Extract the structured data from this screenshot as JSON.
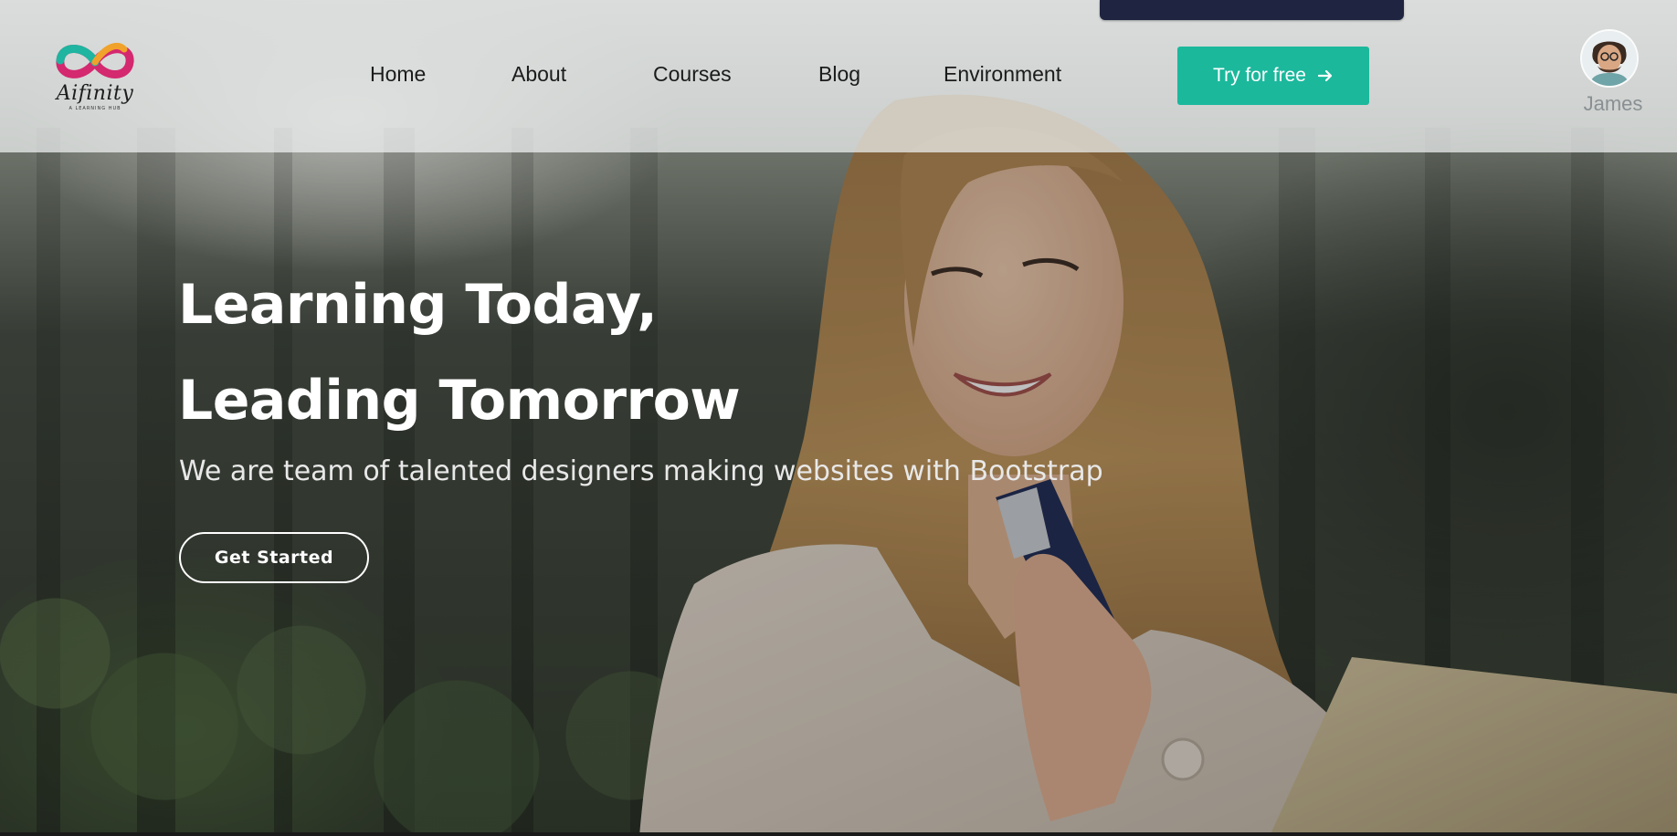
{
  "brand": {
    "name": "Aifinity",
    "tagline": "A LEARNING HUB"
  },
  "nav": {
    "items": [
      {
        "label": "Home"
      },
      {
        "label": "About"
      },
      {
        "label": "Courses"
      },
      {
        "label": "Blog"
      },
      {
        "label": "Environment"
      }
    ],
    "cta_label": "Try for free",
    "cta_icon": "arrow-right-icon"
  },
  "user": {
    "name": "James",
    "avatar_icon": "user-avatar"
  },
  "hero": {
    "title_line1": "Learning Today,",
    "title_line2": "Leading Tomorrow",
    "subtitle": "We are team of talented designers making websites with Bootstrap",
    "button_label": "Get Started"
  },
  "colors": {
    "accent": "#1bb89c",
    "header_overlay": "#f0f2f2",
    "dark_tab": "#1f2440",
    "nav_text": "#1b1b1b",
    "user_name": "#8a8f93"
  }
}
